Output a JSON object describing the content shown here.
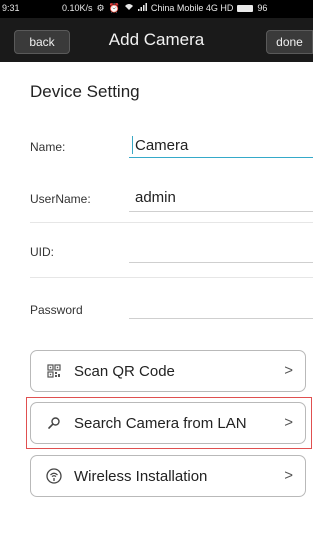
{
  "status_bar": {
    "time": "9:31",
    "net_speed": "0.10K/s",
    "carrier": "China Mobile 4G HD",
    "battery": "96"
  },
  "nav": {
    "back_label": "back",
    "title": "Add Camera",
    "done_label": "done"
  },
  "section_title": "Device Setting",
  "fields": {
    "name": {
      "label": "Name:",
      "value": "Camera"
    },
    "username": {
      "label": "UserName:",
      "value": "admin"
    },
    "uid": {
      "label": "UID:",
      "value": ""
    },
    "password": {
      "label": "Password",
      "value": ""
    }
  },
  "buttons": {
    "scan_qr": {
      "label": "Scan QR Code",
      "icon": "qr-code-icon"
    },
    "search_lan": {
      "label": "Search Camera from LAN",
      "icon": "search-icon"
    },
    "wireless": {
      "label": "Wireless Installation",
      "icon": "wireless-icon"
    }
  },
  "colors": {
    "accent_underline": "#35a9c9",
    "highlight_box": "#e05050"
  }
}
